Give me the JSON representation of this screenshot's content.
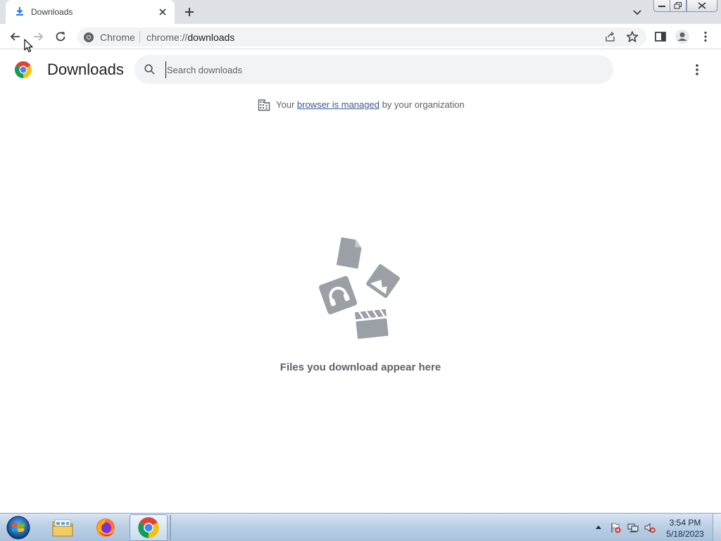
{
  "tab": {
    "title": "Downloads"
  },
  "toolbar": {
    "site_name": "Chrome",
    "url_scheme": "chrome://",
    "url_host": "downloads"
  },
  "page": {
    "title": "Downloads",
    "search_placeholder": "Search downloads",
    "managed": {
      "prefix": "Your ",
      "link": "browser is managed",
      "suffix": " by your organization"
    },
    "empty_message": "Files you download appear here"
  },
  "taskbar": {
    "time": "3:54 PM",
    "date": "5/18/2023"
  },
  "colors": {
    "tabstrip": "#dee1e6",
    "omnibox": "#f1f3f4",
    "link": "#3c5a99",
    "empty_art": "#9aa0a6"
  }
}
